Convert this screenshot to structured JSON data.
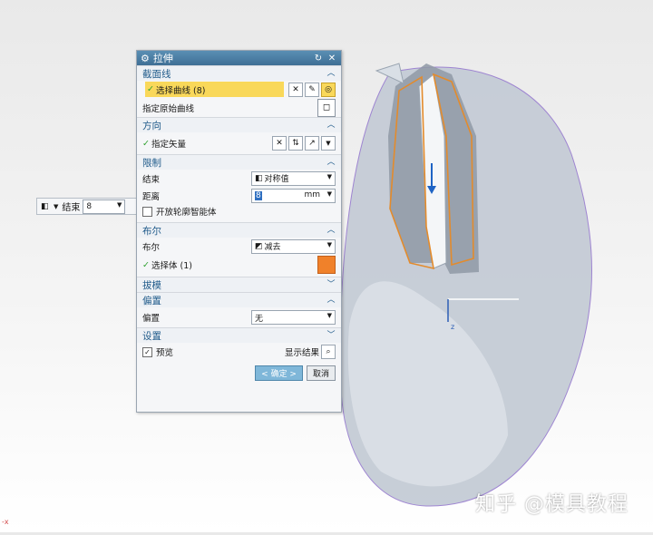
{
  "dialog": {
    "title": "拉伸",
    "sections": {
      "section_curve": {
        "title": "截面线",
        "select_curve": "选择曲线 (8)",
        "specify_origin": "指定原始曲线"
      },
      "direction": {
        "title": "方向",
        "specify_vector": "指定矢量"
      },
      "limits": {
        "title": "限制",
        "end_label": "结束",
        "end_value": "对称值",
        "distance_label": "距离",
        "distance_value": "8",
        "distance_unit": "mm",
        "open_profile": "开放轮廓智能体"
      },
      "boolean": {
        "title": "布尔",
        "boolean_label": "布尔",
        "boolean_value": "减去",
        "select_body": "选择体 (1)"
      },
      "draft": {
        "title": "拔模"
      },
      "offset": {
        "title": "偏置",
        "offset_label": "偏置",
        "offset_value": "无"
      },
      "settings": {
        "title": "设置"
      }
    },
    "preview_label": "预览",
    "show_result": "显示结果",
    "ok_label": "< 确定 >",
    "cancel_label": "取消"
  },
  "side_input": {
    "label": "结束",
    "value": "8"
  },
  "watermark": "知乎 @模具教程",
  "axis_label": "z",
  "corner_label": "-x",
  "colors": {
    "title_bar": "#4a7fa6",
    "highlight": "#f9d85a",
    "section_text": "#1f5a8a",
    "selected_curve": "#e38b2c",
    "body_fill": "#c5ccd6",
    "ok_button": "#7fb7d9"
  }
}
